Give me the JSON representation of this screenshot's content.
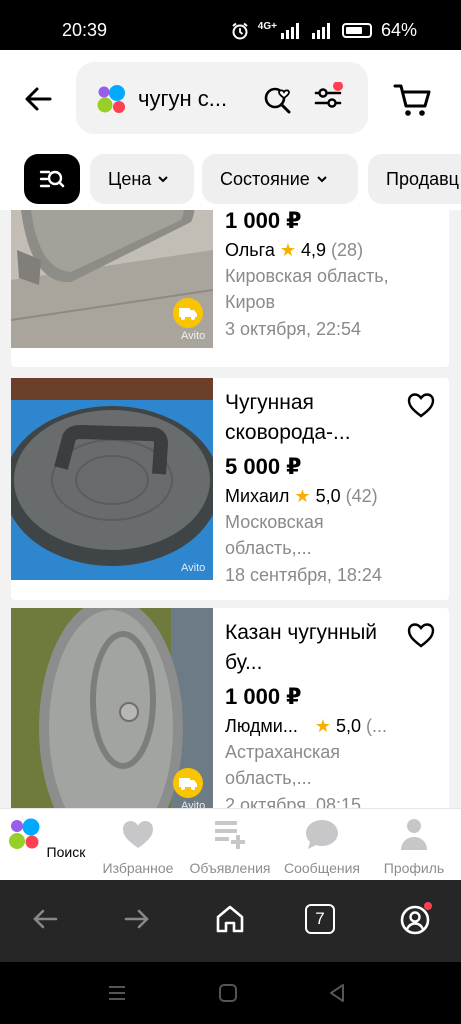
{
  "status_bar": {
    "time": "20:39",
    "network": "4G+",
    "battery": "64%"
  },
  "header": {
    "search_query": "чугун с..."
  },
  "chips": [
    "Цена",
    "Состояние",
    "Продавц"
  ],
  "listings": [
    {
      "title": "",
      "price": "1 000 ₽",
      "seller": "Ольга",
      "rating": "4,9",
      "reviews": "(28)",
      "location": "Кировская область, Киров",
      "date": "3 октября, 22:54"
    },
    {
      "title": "Чугунная сковорода-...",
      "price": "5 000 ₽",
      "seller": "Михаил",
      "rating": "5,0",
      "reviews": "(42)",
      "location": "Московская область,...",
      "date": "18 сентября, 18:24"
    },
    {
      "title": "Казан чугунный бу...",
      "price": "1 000 ₽",
      "seller": "Людми...",
      "rating": "5,0",
      "reviews": "(...",
      "location": "Астраханская область,...",
      "date": "2 октября, 08:15"
    }
  ],
  "watermark": "Avito",
  "tabbar": [
    {
      "label": "Поиск",
      "icon": "avito-dots-icon",
      "active": true
    },
    {
      "label": "Избранное",
      "icon": "heart-icon"
    },
    {
      "label": "Объявления",
      "icon": "ads-icon"
    },
    {
      "label": "Сообщения",
      "icon": "chat-icon"
    },
    {
      "label": "Профиль",
      "icon": "person-icon"
    }
  ],
  "browser_bar": {
    "tab_count": "7"
  },
  "colors": {
    "star": "#f8b000",
    "delivery_badge": "#f9c400",
    "notification": "#ff4053",
    "logo_blue": "#00aaff",
    "logo_green": "#97cf26",
    "logo_red": "#ff4053",
    "logo_purple": "#965eeb"
  }
}
